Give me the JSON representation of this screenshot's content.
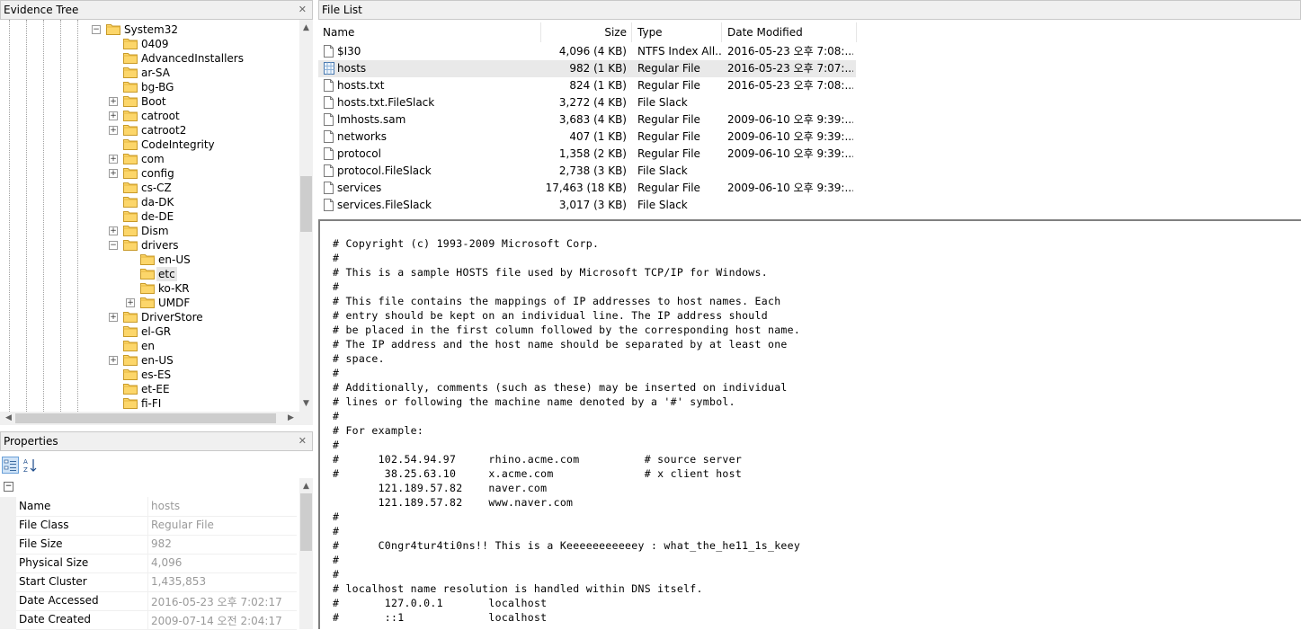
{
  "evidence_tree": {
    "title": "Evidence Tree",
    "items": [
      {
        "label": "System32",
        "level": 0,
        "expander": "minus"
      },
      {
        "label": "0409",
        "level": 1,
        "expander": ""
      },
      {
        "label": "AdvancedInstallers",
        "level": 1,
        "expander": ""
      },
      {
        "label": "ar-SA",
        "level": 1,
        "expander": ""
      },
      {
        "label": "bg-BG",
        "level": 1,
        "expander": ""
      },
      {
        "label": "Boot",
        "level": 1,
        "expander": "plus"
      },
      {
        "label": "catroot",
        "level": 1,
        "expander": "plus"
      },
      {
        "label": "catroot2",
        "level": 1,
        "expander": "plus"
      },
      {
        "label": "CodeIntegrity",
        "level": 1,
        "expander": ""
      },
      {
        "label": "com",
        "level": 1,
        "expander": "plus"
      },
      {
        "label": "config",
        "level": 1,
        "expander": "plus"
      },
      {
        "label": "cs-CZ",
        "level": 1,
        "expander": ""
      },
      {
        "label": "da-DK",
        "level": 1,
        "expander": ""
      },
      {
        "label": "de-DE",
        "level": 1,
        "expander": ""
      },
      {
        "label": "Dism",
        "level": 1,
        "expander": "plus"
      },
      {
        "label": "drivers",
        "level": 1,
        "expander": "minus"
      },
      {
        "label": "en-US",
        "level": 2,
        "expander": ""
      },
      {
        "label": "etc",
        "level": 2,
        "expander": "",
        "selected": true
      },
      {
        "label": "ko-KR",
        "level": 2,
        "expander": ""
      },
      {
        "label": "UMDF",
        "level": 2,
        "expander": "plus"
      },
      {
        "label": "DriverStore",
        "level": 1,
        "expander": "plus"
      },
      {
        "label": "el-GR",
        "level": 1,
        "expander": ""
      },
      {
        "label": "en",
        "level": 1,
        "expander": ""
      },
      {
        "label": "en-US",
        "level": 1,
        "expander": "plus"
      },
      {
        "label": "es-ES",
        "level": 1,
        "expander": ""
      },
      {
        "label": "et-EE",
        "level": 1,
        "expander": ""
      },
      {
        "label": "fi-FI",
        "level": 1,
        "expander": ""
      }
    ]
  },
  "properties": {
    "title": "Properties",
    "rows": [
      {
        "name": "Name",
        "value": "hosts"
      },
      {
        "name": "File Class",
        "value": "Regular File"
      },
      {
        "name": "File Size",
        "value": "982"
      },
      {
        "name": "Physical Size",
        "value": "4,096"
      },
      {
        "name": "Start Cluster",
        "value": "1,435,853"
      },
      {
        "name": "Date Accessed",
        "value": "2016-05-23 오후 7:02:17"
      },
      {
        "name": "Date Created",
        "value": "2009-07-14 오전 2:04:17"
      }
    ]
  },
  "file_list": {
    "title": "File List",
    "columns": {
      "name": "Name",
      "size": "Size",
      "type": "Type",
      "date": "Date Modified"
    },
    "rows": [
      {
        "name": "$I30",
        "size": "4,096 (4 KB)",
        "type": "NTFS Index All...",
        "date": "2016-05-23 오후 7:08:..."
      },
      {
        "name": "hosts",
        "size": "982 (1 KB)",
        "type": "Regular File",
        "date": "2016-05-23 오후 7:07:...",
        "selected": true
      },
      {
        "name": "hosts.txt",
        "size": "824 (1 KB)",
        "type": "Regular File",
        "date": "2016-05-23 오후 7:08:..."
      },
      {
        "name": "hosts.txt.FileSlack",
        "size": "3,272 (4 KB)",
        "type": "File Slack",
        "date": ""
      },
      {
        "name": "lmhosts.sam",
        "size": "3,683 (4 KB)",
        "type": "Regular File",
        "date": "2009-06-10 오후 9:39:..."
      },
      {
        "name": "networks",
        "size": "407 (1 KB)",
        "type": "Regular File",
        "date": "2009-06-10 오후 9:39:..."
      },
      {
        "name": "protocol",
        "size": "1,358 (2 KB)",
        "type": "Regular File",
        "date": "2009-06-10 오후 9:39:..."
      },
      {
        "name": "protocol.FileSlack",
        "size": "2,738 (3 KB)",
        "type": "File Slack",
        "date": ""
      },
      {
        "name": "services",
        "size": "17,463 (18 KB)",
        "type": "Regular File",
        "date": "2009-06-10 오후 9:39:..."
      },
      {
        "name": "services.FileSlack",
        "size": "3,017 (3 KB)",
        "type": "File Slack",
        "date": ""
      }
    ]
  },
  "viewer": {
    "content": "# Copyright (c) 1993-2009 Microsoft Corp.\n#\n# This is a sample HOSTS file used by Microsoft TCP/IP for Windows.\n#\n# This file contains the mappings of IP addresses to host names. Each\n# entry should be kept on an individual line. The IP address should\n# be placed in the first column followed by the corresponding host name.\n# The IP address and the host name should be separated by at least one\n# space.\n#\n# Additionally, comments (such as these) may be inserted on individual\n# lines or following the machine name denoted by a '#' symbol.\n#\n# For example:\n#\n#      102.54.94.97     rhino.acme.com          # source server\n#       38.25.63.10     x.acme.com              # x client host\n       121.189.57.82    naver.com\n       121.189.57.82    www.naver.com\n#\n#\n#      C0ngr4tur4ti0ns!! This is a Keeeeeeeeeeey : what_the_he11_1s_keey\n#\n#\n# localhost name resolution is handled within DNS itself.\n#\t127.0.0.1       localhost\n#\t::1             localhost"
  }
}
